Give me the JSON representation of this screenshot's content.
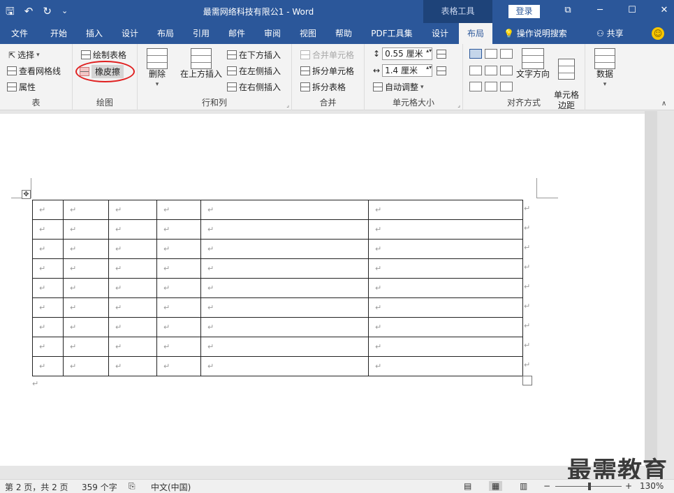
{
  "window": {
    "title": "最需网络科技有限公1  -  Word",
    "context_tab": "表格工具",
    "login": "登录",
    "quick_access": [
      "save-icon",
      "undo-icon",
      "redo-icon",
      "customize-icon"
    ],
    "controls": [
      "ribbon-display-icon",
      "minimize-icon",
      "maximize-icon",
      "close-icon"
    ]
  },
  "tabs": [
    "文件",
    "开始",
    "插入",
    "设计",
    "布局",
    "引用",
    "邮件",
    "审阅",
    "视图",
    "帮助",
    "PDF工具集",
    "设计",
    "布局"
  ],
  "active_tab": "布局",
  "tell_me": "操作说明搜索",
  "share": "共享",
  "ribbon": {
    "table_group": {
      "label": "表",
      "select": "选择",
      "view_gridlines": "查看网格线",
      "properties": "属性"
    },
    "draw_group": {
      "label": "绘图",
      "draw_table": "绘制表格",
      "eraser": "橡皮擦"
    },
    "rows_cols_group": {
      "label": "行和列",
      "delete": "删除",
      "insert_above": "在上方插入",
      "insert_below": "在下方插入",
      "insert_left": "在左侧插入",
      "insert_right": "在右侧插入"
    },
    "merge_group": {
      "label": "合并",
      "merge_cells": "合并单元格",
      "split_cells": "拆分单元格",
      "split_table": "拆分表格"
    },
    "cell_size_group": {
      "label": "单元格大小",
      "height": "0.55 厘米",
      "width": "1.4 厘米",
      "autofit": "自动调整"
    },
    "alignment_group": {
      "label": "对齐方式",
      "text_direction": "文字方向",
      "cell_margins": "单元格\n边距"
    },
    "data_group": {
      "label": "数据"
    }
  },
  "document": {
    "table_rows": 9,
    "table_cols": 6,
    "cell_mark": "↵"
  },
  "status": {
    "page": "第 2 页，共 2 页",
    "words": "359 个字",
    "language": "中文(中国)",
    "zoom": "130%",
    "zoom_level_percent": 130
  },
  "watermark": "最需教育"
}
